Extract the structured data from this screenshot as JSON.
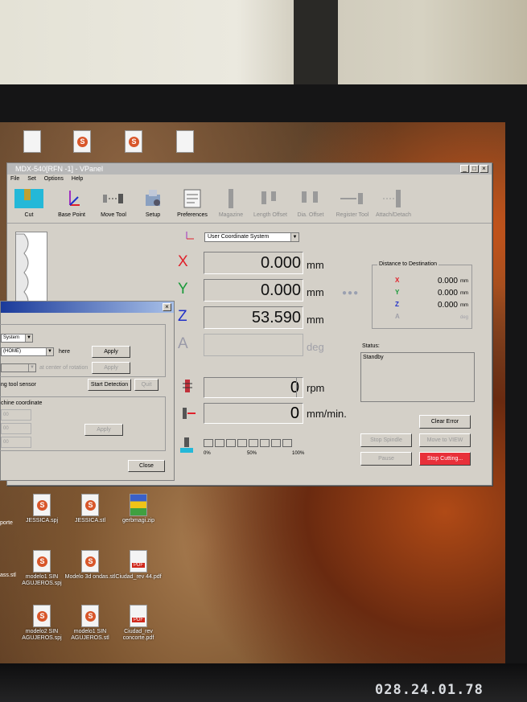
{
  "desktop": {
    "icons": [
      {
        "label": "",
        "type": "doc"
      },
      {
        "label": "",
        "type": "stl"
      },
      {
        "label": "",
        "type": "stl"
      },
      {
        "label": "",
        "type": "doc"
      },
      {
        "label": "JESSICA.spj",
        "type": "stl"
      },
      {
        "label": "JESSICA.stl",
        "type": "stl"
      },
      {
        "label": "gerbmagi.zip",
        "type": "zip"
      },
      {
        "label": "modelo1 SIN AGUJEROS.spj",
        "type": "stl"
      },
      {
        "label": "Modelo 3d ondas.stl",
        "type": "stl"
      },
      {
        "label": "Ciudad_rev 44.pdf",
        "type": "pdf"
      },
      {
        "label": "modelo2 SIN AGUJEROS.spj",
        "type": "stl"
      },
      {
        "label": "modelo1 SIN AGUJEROS.stl",
        "type": "stl"
      },
      {
        "label": "Ciudad_rev concorte.pdf",
        "type": "pdf"
      }
    ],
    "edge_labels": [
      "porte",
      "ass.stl"
    ]
  },
  "window": {
    "title": "MDX-540[RFN -1] - VPanel",
    "controls": [
      "_",
      "□",
      "×"
    ],
    "menu": [
      "File",
      "Set",
      "Options",
      "Help"
    ]
  },
  "toolbar": [
    {
      "label": "Cut",
      "enabled": true,
      "icon": "cut-icon"
    },
    {
      "label": "Base Point",
      "enabled": true,
      "icon": "base-point-icon"
    },
    {
      "label": "Move Tool",
      "enabled": true,
      "icon": "move-tool-icon"
    },
    {
      "label": "Setup",
      "enabled": true,
      "icon": "setup-icon"
    },
    {
      "label": "Preferences",
      "enabled": true,
      "icon": "preferences-icon"
    },
    {
      "label": "Magazine",
      "enabled": false,
      "icon": "magazine-icon"
    },
    {
      "label": "Length Offset",
      "enabled": false,
      "icon": "length-offset-icon"
    },
    {
      "label": "Dia. Offset",
      "enabled": false,
      "icon": "dia-offset-icon"
    },
    {
      "label": "Register Tool",
      "enabled": false,
      "icon": "register-tool-icon"
    },
    {
      "label": "Attach/Detach",
      "enabled": false,
      "icon": "attach-detach-icon"
    }
  ],
  "coordinate_system": "User Coordinate System",
  "axes": [
    {
      "name": "X",
      "value": "0.000",
      "unit": "mm",
      "color": "#e0202a"
    },
    {
      "name": "Y",
      "value": "0.000",
      "unit": "mm",
      "color": "#1a9a3a"
    },
    {
      "name": "Z",
      "value": "53.590",
      "unit": "mm",
      "color": "#2030c8"
    },
    {
      "name": "A",
      "value": "",
      "unit": "deg",
      "color": "#9a9aa8"
    }
  ],
  "distance": {
    "title": "Distance to Destination",
    "rows": [
      {
        "axis": "X",
        "value": "0.000",
        "unit": "mm",
        "color": "#e0202a"
      },
      {
        "axis": "Y",
        "value": "0.000",
        "unit": "mm",
        "color": "#1a9a3a"
      },
      {
        "axis": "Z",
        "value": "0.000",
        "unit": "mm",
        "color": "#2030c8"
      },
      {
        "axis": "A",
        "value": "",
        "unit": "deg",
        "color": "#9a9aa8"
      }
    ]
  },
  "status": {
    "label": "Status:",
    "text": "Standby"
  },
  "spindle": {
    "value": "0",
    "unit": "rpm"
  },
  "feed": {
    "value": "0",
    "unit": "mm/min."
  },
  "progress": {
    "segments": 8,
    "labels": [
      "0%",
      "50%",
      "100%"
    ]
  },
  "buttons": {
    "clear_error": "Clear Error",
    "stop_spindle": "Stop Spindle",
    "move_to_view": "Move to VIEW",
    "pause": "Pause",
    "stop_cutting": "Stop Cutting..."
  },
  "dialog": {
    "close_glyph": "×",
    "system_select": "System",
    "home_select": "(HOME)",
    "here": "here",
    "apply1": "Apply",
    "rotation_text": "at center of rotation",
    "apply2": "Apply",
    "tool_sensor": "ng tool sensor",
    "start_detection": "Start Detection",
    "quit": "Quit",
    "machine_coord": "chine coordinate",
    "field1": "00",
    "field2": "00",
    "field3": "00",
    "apply3": "Apply",
    "close": "Close"
  },
  "sticker": "028.24.01.78"
}
